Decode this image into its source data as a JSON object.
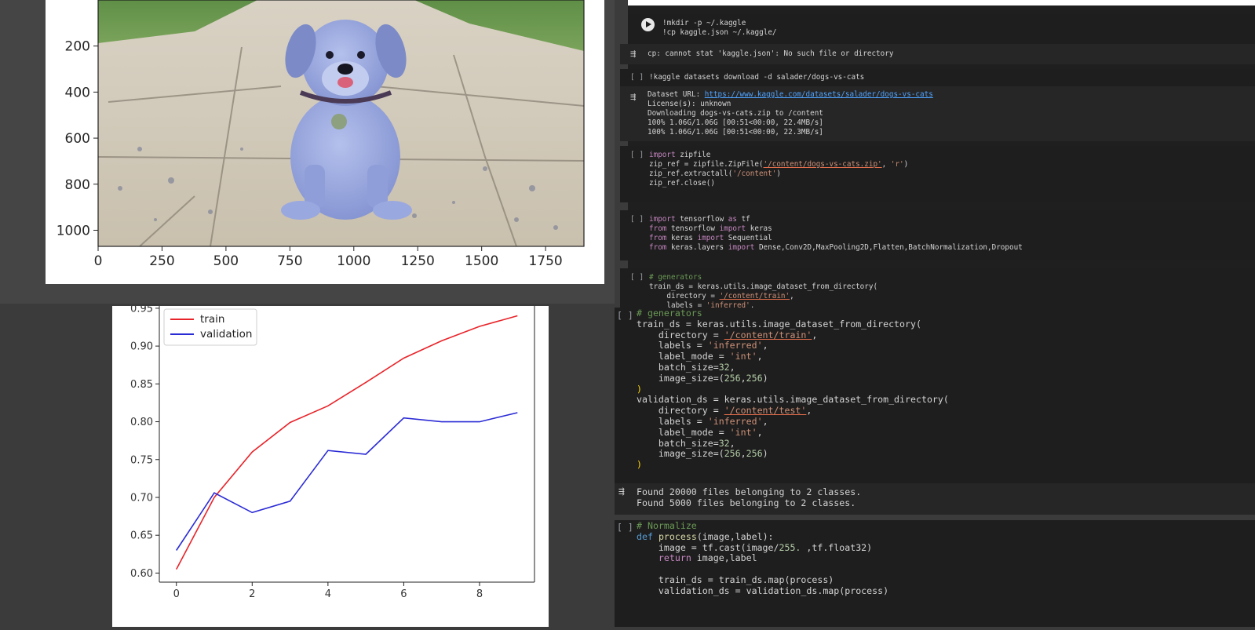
{
  "image_plot": {
    "x_ticks": [
      "0",
      "250",
      "500",
      "750",
      "1000",
      "1250",
      "1500",
      "1750"
    ],
    "y_ticks": [
      "200",
      "400",
      "600",
      "800",
      "1000"
    ],
    "x_range": [
      0,
      1900
    ],
    "y_range": [
      1070,
      0
    ],
    "image_subject": "puppy-photo"
  },
  "chart_data": {
    "type": "line",
    "x": [
      0,
      1,
      2,
      3,
      4,
      5,
      6,
      7,
      8,
      9
    ],
    "series": [
      {
        "name": "train",
        "color": "#e8242a",
        "values": [
          0.605,
          0.7,
          0.76,
          0.799,
          0.821,
          0.852,
          0.884,
          0.907,
          0.926,
          0.94
        ]
      },
      {
        "name": "validation",
        "color": "#2b2bd6",
        "values": [
          0.63,
          0.706,
          0.68,
          0.695,
          0.762,
          0.757,
          0.805,
          0.8,
          0.8,
          0.812
        ]
      }
    ],
    "x_ticks": [
      "0",
      "2",
      "4",
      "6",
      "8"
    ],
    "y_ticks": [
      "0.60",
      "0.65",
      "0.70",
      "0.75",
      "0.80",
      "0.85",
      "0.90",
      "0.95"
    ],
    "xlim": [
      -0.45,
      9.45
    ],
    "ylim": [
      0.588,
      0.953
    ],
    "legend": "top-left",
    "grid": false
  },
  "small_notebook": {
    "cell1": {
      "line1": "!mkdir -p ~/.kaggle",
      "line2": "!cp kaggle.json ~/.kaggle/"
    },
    "out1": "cp: cannot stat 'kaggle.json': No such file or directory",
    "cell2": {
      "gutter": "[ ]",
      "code": "!kaggle datasets download -d salader/dogs-vs-cats"
    },
    "out2": {
      "url_label": "Dataset URL: ",
      "url": "https://www.kaggle.com/datasets/salader/dogs-vs-cats",
      "license": "License(s): unknown",
      "downloading": "Downloading dogs-vs-cats.zip to /content",
      "progress1": "100% 1.06G/1.06G [00:51<00:00, 22.4MB/s]",
      "progress2": "100% 1.06G/1.06G [00:51<00:00, 22.3MB/s]"
    },
    "cell3": {
      "gutter": "[ ]",
      "l1_kw": "import",
      "l1_rest": " zipfile",
      "l2_a": "zip_ref = zipfile.ZipFile(",
      "l2_s1": "'/content/dogs-vs-cats.zip'",
      "l2_b": ", ",
      "l2_s2": "'r'",
      "l2_c": ")",
      "l3_a": "zip_ref.extractall(",
      "l3_s": "'/content'",
      "l3_c": ")",
      "l4": "zip_ref.close()"
    },
    "cell4": {
      "gutter": "[ ]",
      "l1_kw": "import",
      "l1_rest": " tensorflow ",
      "l1_kw2": "as",
      "l1_rest2": " tf",
      "l2_kw": "from",
      "l2_rest": " tensorflow ",
      "l2_kw2": "import",
      "l2_rest2": " keras",
      "l3_kw": "from",
      "l3_rest": " keras ",
      "l3_kw2": "import",
      "l3_rest2": " Sequential",
      "l4_kw": "from",
      "l4_rest": " keras.layers ",
      "l4_kw2": "import",
      "l4_rest2": " Dense,Conv2D,MaxPooling2D,Flatten,BatchNormalization,Dropout"
    },
    "cell5": {
      "gutter": "[ ]",
      "l1": "# generators",
      "l2": "train_ds = keras.utils.image_dataset_from_directory(",
      "l3_a": "directory = ",
      "l3_s": "'/content/train'",
      "l3_c": ",",
      "l4_a": "labels = ",
      "l4_s": "'inferred'",
      "l4_c": ","
    }
  },
  "big_notebook": {
    "cell": {
      "gutter": "[ ]",
      "comment": "# generators",
      "train_line": "train_ds = keras.utils.image_dataset_from_directory(",
      "dir_label": "directory = ",
      "train_dir": "'/content/train'",
      "labels_label": "labels = ",
      "labels_val": "'inferred'",
      "mode_label": "label_mode = ",
      "mode_val": "'int'",
      "batch_label": "batch_size=",
      "batch_val": "32",
      "size_label": "image_size=(",
      "size_w": "256",
      "size_h": "256",
      "close": ")",
      "val_line": "validation_ds = keras.utils.image_dataset_from_directory(",
      "test_dir": "'/content/test'"
    },
    "output": {
      "line1": "Found 20000 files belonging to 2 classes.",
      "line2": "Found 5000 files belonging to 2 classes."
    },
    "norm_cell": {
      "gutter": "[ ]",
      "comment": "# Normalize",
      "def_kw": "def",
      "fn_name": "process",
      "params": "(image,label):",
      "l2_a": "image = tf.cast(image/",
      "l2_num": "255.",
      "l2_b": " ,tf.float32)",
      "ret_kw": "return",
      "ret_rest": " image,label",
      "l4": "train_ds = train_ds.map(process)",
      "l5": "validation_ds = validation_ds.map(process)"
    }
  }
}
